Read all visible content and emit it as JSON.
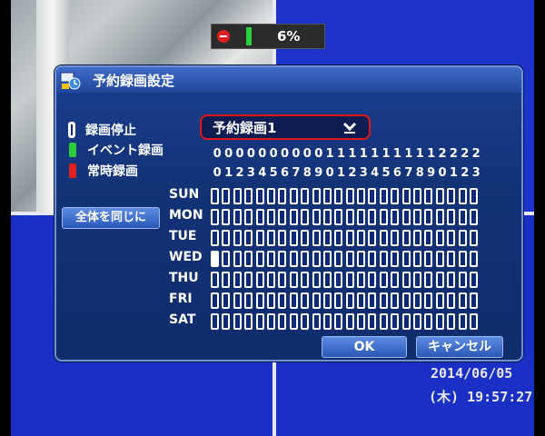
{
  "hdd": {
    "usage_text": "6%"
  },
  "dialog": {
    "title": "予約録画設定",
    "legend": {
      "stop": "録画停止",
      "event": "イベント録画",
      "continuous": "常時録画"
    },
    "schedule_select": {
      "value": "予約録画1"
    },
    "copy_all_label": "全体を同じに",
    "hour_tens": [
      "0",
      "0",
      "0",
      "0",
      "0",
      "0",
      "0",
      "0",
      "0",
      "0",
      "1",
      "1",
      "1",
      "1",
      "1",
      "1",
      "1",
      "1",
      "1",
      "1",
      "2",
      "2",
      "2",
      "2"
    ],
    "hour_ones": [
      "0",
      "1",
      "2",
      "3",
      "4",
      "5",
      "6",
      "7",
      "8",
      "9",
      "0",
      "1",
      "2",
      "3",
      "4",
      "5",
      "6",
      "7",
      "8",
      "9",
      "0",
      "1",
      "2",
      "3"
    ],
    "days": [
      "SUN",
      "MON",
      "TUE",
      "WED",
      "THU",
      "FRI",
      "SAT"
    ],
    "selected_cell": {
      "day": "WED",
      "hour": 0
    },
    "ok_label": "OK",
    "cancel_label": "キャンセル"
  },
  "clock": {
    "date": "2014/06/05",
    "time": "(木) 19:57:27"
  },
  "colors": {
    "stop": "#0e2a74",
    "event": "#2bcb3a",
    "continuous": "#e02020",
    "highlight_border": "#e01818"
  }
}
